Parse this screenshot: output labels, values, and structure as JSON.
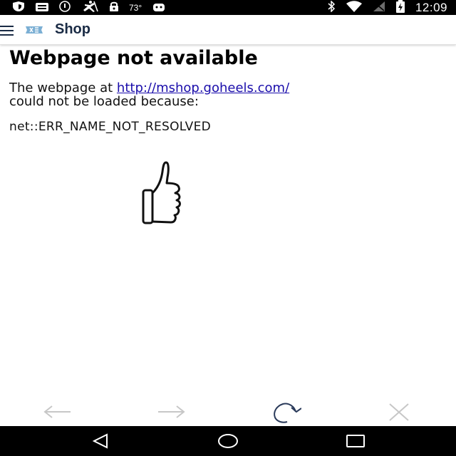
{
  "status_bar": {
    "temperature": "73°",
    "time": "12:09",
    "left_icons": [
      "shield-icon",
      "email-icon",
      "alert-icon",
      "transit-icon",
      "lock-icon",
      "android-icon"
    ],
    "right_icons": [
      "bluetooth-icon",
      "wifi-icon",
      "signal-icon",
      "battery-charging-icon"
    ]
  },
  "app_bar": {
    "title": "Shop",
    "logo": "unc-logo",
    "logo_color": "#7BAFD4",
    "title_color": "#1a2b45"
  },
  "error": {
    "title": "Webpage not available",
    "msg_prefix": "The webpage at ",
    "url": "http://mshop.goheels.com/",
    "msg_suffix": "could not be loaded because:",
    "code": "net::ERR_NAME_NOT_RESOLVED",
    "link_color": "#1a0dab"
  },
  "browser_controls": [
    "back-arrow-icon",
    "forward-arrow-icon",
    "reload-icon",
    "stop-icon"
  ],
  "nav_bar": [
    "back-triangle-icon",
    "home-circle-icon",
    "recents-square-icon"
  ]
}
